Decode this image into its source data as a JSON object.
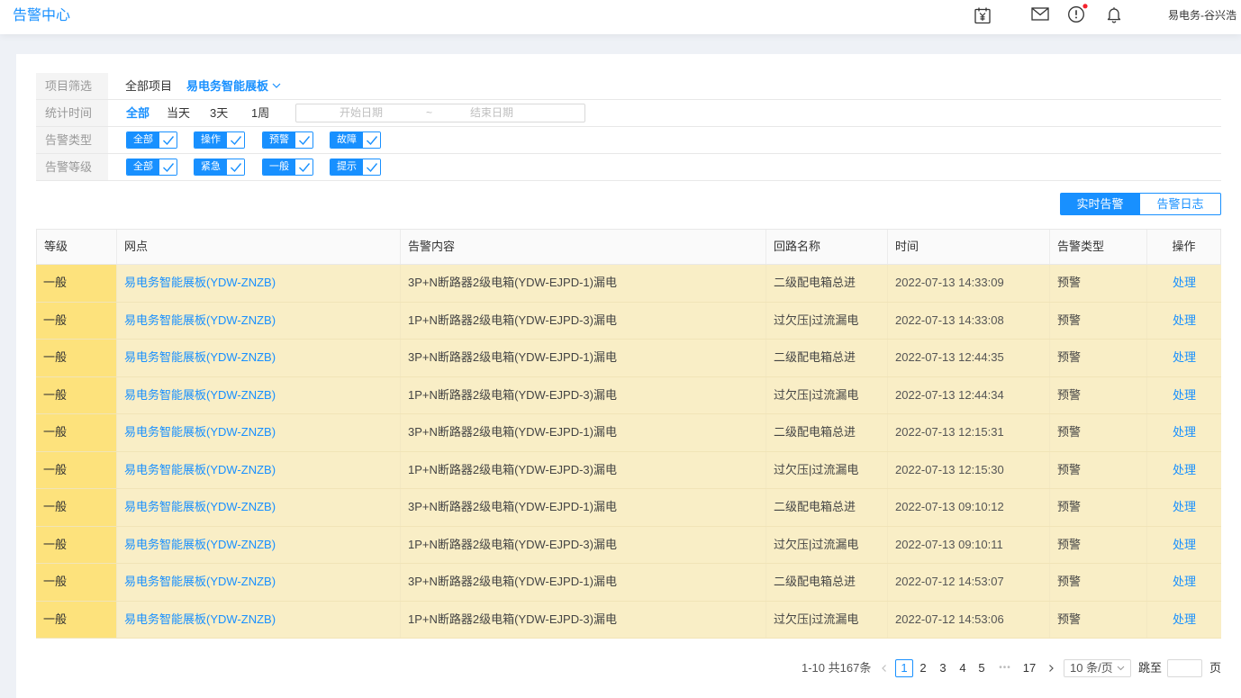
{
  "header": {
    "title": "告警中心",
    "user_name": "易电务-谷兴浩"
  },
  "icons": {
    "calendar": "calendar-yen-icon",
    "mail": "mail-icon",
    "alert": "alert-icon",
    "bell": "bell-icon",
    "project_dropdown": "chevron-down-icon",
    "checkbox": "check-icon",
    "prev_page": "chevron-left-icon",
    "next_page": "chevron-right-icon"
  },
  "colors": {
    "accent": "#1890ff",
    "level_bg": "#fde27c",
    "row_bg": "#f9eec6",
    "notice_dot": "#f5222d"
  },
  "filters": {
    "project": {
      "label": "项目筛选",
      "all_label": "全部项目",
      "selected": "易电务智能展板"
    },
    "time": {
      "label": "统计时间",
      "options": [
        {
          "label": "全部",
          "active": true
        },
        {
          "label": "当天",
          "active": false
        },
        {
          "label": "3天",
          "active": false
        },
        {
          "label": "1周",
          "active": false
        }
      ],
      "start_placeholder": "开始日期",
      "separator": "~",
      "end_placeholder": "结束日期"
    },
    "alarm_type": {
      "label": "告警类型",
      "options": [
        {
          "label": "全部",
          "checked": true
        },
        {
          "label": "操作",
          "checked": true
        },
        {
          "label": "预警",
          "checked": true
        },
        {
          "label": "故障",
          "checked": true
        }
      ]
    },
    "alarm_level": {
      "label": "告警等级",
      "options": [
        {
          "label": "全部",
          "checked": true
        },
        {
          "label": "紧急",
          "checked": true
        },
        {
          "label": "一般",
          "checked": true
        },
        {
          "label": "提示",
          "checked": true
        }
      ]
    }
  },
  "tabs": [
    {
      "label": "实时告警",
      "active": true
    },
    {
      "label": "告警日志",
      "active": false
    }
  ],
  "table": {
    "columns": [
      "等级",
      "网点",
      "告警内容",
      "回路名称",
      "时间",
      "告警类型",
      "操作"
    ],
    "rows": [
      {
        "level": "一般",
        "site": "易电务智能展板(YDW-ZNZB)",
        "content": "3P+N断路器2级电箱(YDW-EJPD-1)漏电",
        "circuit": "二级配电箱总进",
        "time": "2022-07-13 14:33:09",
        "type": "预警",
        "action": "处理"
      },
      {
        "level": "一般",
        "site": "易电务智能展板(YDW-ZNZB)",
        "content": "1P+N断路器2级电箱(YDW-EJPD-3)漏电",
        "circuit": "过欠压|过流漏电",
        "time": "2022-07-13 14:33:08",
        "type": "预警",
        "action": "处理"
      },
      {
        "level": "一般",
        "site": "易电务智能展板(YDW-ZNZB)",
        "content": "3P+N断路器2级电箱(YDW-EJPD-1)漏电",
        "circuit": "二级配电箱总进",
        "time": "2022-07-13 12:44:35",
        "type": "预警",
        "action": "处理"
      },
      {
        "level": "一般",
        "site": "易电务智能展板(YDW-ZNZB)",
        "content": "1P+N断路器2级电箱(YDW-EJPD-3)漏电",
        "circuit": "过欠压|过流漏电",
        "time": "2022-07-13 12:44:34",
        "type": "预警",
        "action": "处理"
      },
      {
        "level": "一般",
        "site": "易电务智能展板(YDW-ZNZB)",
        "content": "3P+N断路器2级电箱(YDW-EJPD-1)漏电",
        "circuit": "二级配电箱总进",
        "time": "2022-07-13 12:15:31",
        "type": "预警",
        "action": "处理"
      },
      {
        "level": "一般",
        "site": "易电务智能展板(YDW-ZNZB)",
        "content": "1P+N断路器2级电箱(YDW-EJPD-3)漏电",
        "circuit": "过欠压|过流漏电",
        "time": "2022-07-13 12:15:30",
        "type": "预警",
        "action": "处理"
      },
      {
        "level": "一般",
        "site": "易电务智能展板(YDW-ZNZB)",
        "content": "3P+N断路器2级电箱(YDW-EJPD-1)漏电",
        "circuit": "二级配电箱总进",
        "time": "2022-07-13 09:10:12",
        "type": "预警",
        "action": "处理"
      },
      {
        "level": "一般",
        "site": "易电务智能展板(YDW-ZNZB)",
        "content": "1P+N断路器2级电箱(YDW-EJPD-3)漏电",
        "circuit": "过欠压|过流漏电",
        "time": "2022-07-13 09:10:11",
        "type": "预警",
        "action": "处理"
      },
      {
        "level": "一般",
        "site": "易电务智能展板(YDW-ZNZB)",
        "content": "3P+N断路器2级电箱(YDW-EJPD-1)漏电",
        "circuit": "二级配电箱总进",
        "time": "2022-07-12 14:53:07",
        "type": "预警",
        "action": "处理"
      },
      {
        "level": "一般",
        "site": "易电务智能展板(YDW-ZNZB)",
        "content": "1P+N断路器2级电箱(YDW-EJPD-3)漏电",
        "circuit": "过欠压|过流漏电",
        "time": "2022-07-12 14:53:06",
        "type": "预警",
        "action": "处理"
      }
    ]
  },
  "pagination": {
    "summary": "1-10 共167条",
    "pages": [
      {
        "label": "1",
        "active": true
      },
      {
        "label": "2",
        "active": false
      },
      {
        "label": "3",
        "active": false
      },
      {
        "label": "4",
        "active": false
      },
      {
        "label": "5",
        "active": false
      }
    ],
    "ellipsis": "•••",
    "last_page": "17",
    "page_size": "10 条/页",
    "jump_label": "跳至",
    "page_suffix": "页"
  }
}
